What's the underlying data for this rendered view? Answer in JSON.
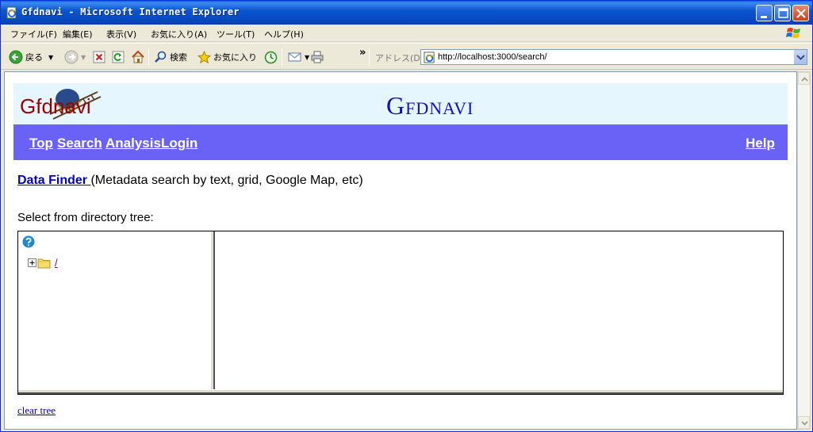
{
  "window": {
    "title": "Gfdnavi - Microsoft Internet Explorer"
  },
  "menu": {
    "items": [
      "ファイル(F)",
      "編集(E)",
      "表示(V)",
      "お気に入り(A)",
      "ツール(T)",
      "ヘルプ(H)"
    ]
  },
  "toolbar": {
    "back_label": "戻る",
    "search_label": "検索",
    "favorites_label": "お気に入り",
    "address_label": "アドレス(D)",
    "url": "http://localhost:3000/search/",
    "chevron": "»"
  },
  "page": {
    "logo_text": "Gfdnavi",
    "site_title": "Gfdnavi",
    "nav": {
      "top": "Top",
      "search": "Search",
      "analysis": "Analysis",
      "login": "Login",
      "help": "Help"
    },
    "finder_link": "Data Finder ",
    "finder_desc": "(Metadata search by text, grid, Google Map, etc)",
    "select_label": "Select from directory tree:",
    "tree_root": "/",
    "clear_tree": "clear tree"
  },
  "colors": {
    "titlebar": "#0b57d0",
    "banner_bg": "#e6f6ff",
    "navbar_bg": "#6a62f6",
    "link": "#0000cc",
    "logo": "#990000",
    "site_title": "#1010c0"
  }
}
